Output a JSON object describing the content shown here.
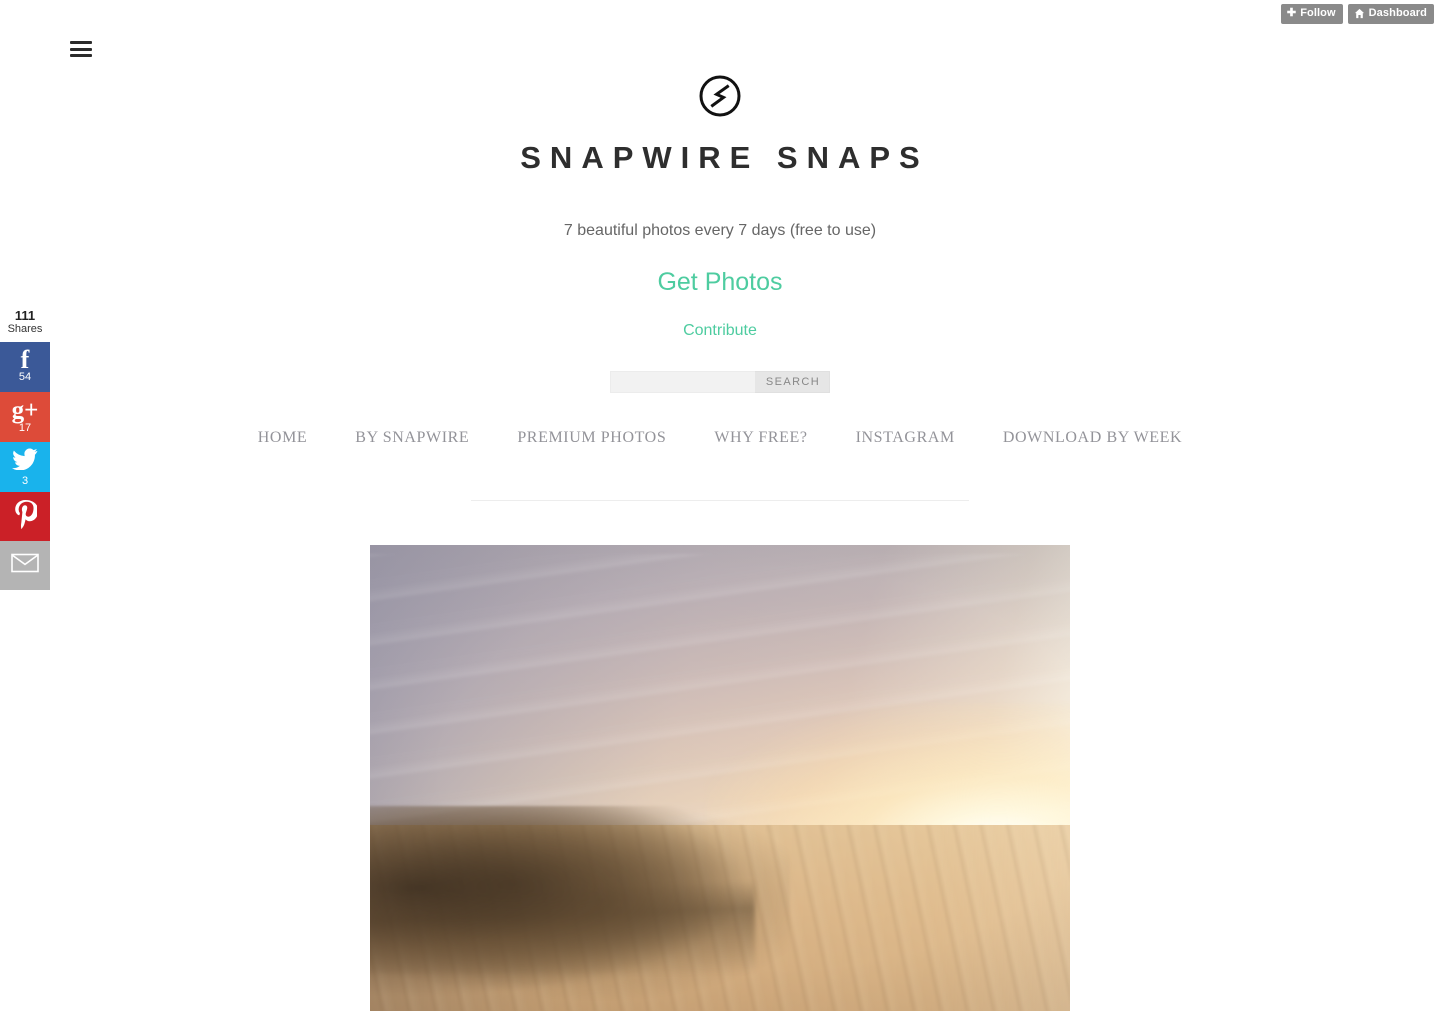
{
  "tumblr_bar": {
    "follow_label": "Follow",
    "follow_icon": "plus-icon",
    "dashboard_label": "Dashboard",
    "dashboard_icon": "house-icon"
  },
  "menu": {
    "icon": "hamburger-icon"
  },
  "header": {
    "logo_icon": "snapwire-circle-s-logo",
    "title": "SNAPWIRE SNAPS",
    "tagline": "7 beautiful photos every 7 days (free to use)",
    "primary_link": "Get Photos",
    "secondary_link": "Contribute",
    "accent_color": "#4ecca0",
    "title_color": "#2e2e2e"
  },
  "search": {
    "value": "",
    "placeholder": "",
    "button_label": "SEARCH"
  },
  "nav": {
    "items": [
      {
        "label": "HOME"
      },
      {
        "label": "BY SNAPWIRE"
      },
      {
        "label": "PREMIUM PHOTOS"
      },
      {
        "label": "WHY FREE?"
      },
      {
        "label": "INSTAGRAM"
      },
      {
        "label": "DOWNLOAD BY WEEK"
      }
    ]
  },
  "share_rail": {
    "total_count": "111",
    "total_label": "Shares",
    "buttons": [
      {
        "name": "facebook",
        "icon": "facebook-icon",
        "glyph": "f",
        "count": "54",
        "color": "#3b5998"
      },
      {
        "name": "google-plus",
        "icon": "google-plus-icon",
        "glyph": "g+",
        "count": "17",
        "color": "#dd4b39"
      },
      {
        "name": "twitter",
        "icon": "twitter-bird-icon",
        "glyph": "",
        "count": "3",
        "color": "#19b3ec"
      },
      {
        "name": "pinterest",
        "icon": "pinterest-icon",
        "glyph": "",
        "count": "",
        "color": "#cb2027"
      },
      {
        "name": "email",
        "icon": "envelope-icon",
        "glyph": "",
        "count": "",
        "color": "#b4b4b4"
      }
    ]
  },
  "post": {
    "photo_alt": "Sunset over coastal sand dunes and ocean"
  }
}
